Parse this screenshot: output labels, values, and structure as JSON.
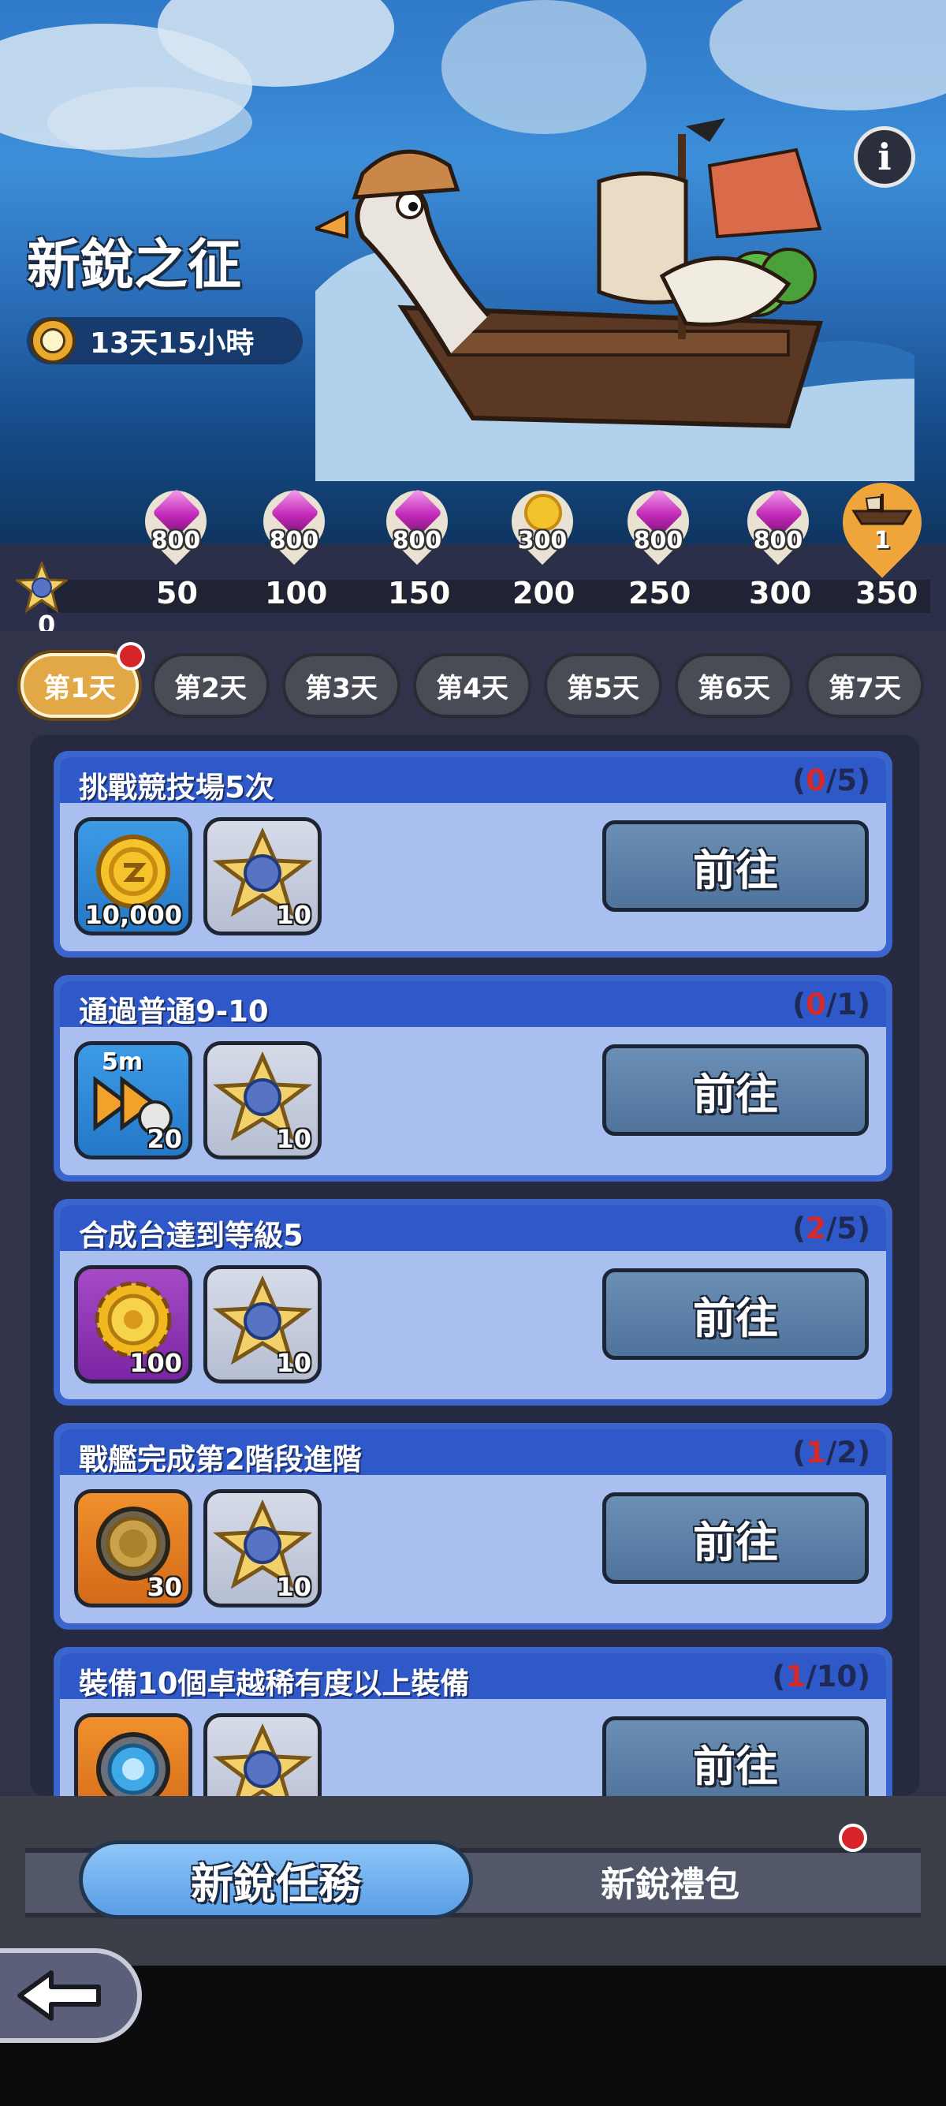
{
  "event": {
    "title": "新銳之征",
    "timer": "13天15小時",
    "info_button": "i"
  },
  "milestones": {
    "start_value": "0",
    "rewards": [
      {
        "points": "50",
        "reward_icon": "gem-icon",
        "amount": "800"
      },
      {
        "points": "100",
        "reward_icon": "gem-icon",
        "amount": "800"
      },
      {
        "points": "150",
        "reward_icon": "gem-icon",
        "amount": "800"
      },
      {
        "points": "200",
        "reward_icon": "gold-gear-icon",
        "amount": "300"
      },
      {
        "points": "250",
        "reward_icon": "gem-icon",
        "amount": "800"
      },
      {
        "points": "300",
        "reward_icon": "gem-icon",
        "amount": "800"
      },
      {
        "points": "350",
        "reward_icon": "ship-icon",
        "amount": "1"
      }
    ]
  },
  "day_tabs": [
    "第1天",
    "第2天",
    "第3天",
    "第4天",
    "第5天",
    "第6天",
    "第7天"
  ],
  "active_day": "第1天",
  "quests": [
    {
      "title": "挑戰競技場5次",
      "open": "(",
      "current": "0",
      "total": "/5)",
      "rewards": [
        {
          "icon": "gold-coin-icon",
          "count": "10,000"
        },
        {
          "icon": "anchor-star-icon",
          "count": "10"
        }
      ],
      "button": "前往"
    },
    {
      "title": "通過普通9-10",
      "open": "(",
      "current": "0",
      "total": "/1)",
      "rewards": [
        {
          "icon": "fast-forward-5m-icon",
          "label": "5m",
          "count": "20"
        },
        {
          "icon": "anchor-star-icon",
          "count": "10"
        }
      ],
      "button": "前往"
    },
    {
      "title": "合成台達到等級5",
      "open": "(",
      "current": "2",
      "total": "/5)",
      "rewards": [
        {
          "icon": "gold-gear-icon",
          "count": "100"
        },
        {
          "icon": "anchor-star-icon",
          "count": "10"
        }
      ],
      "button": "前往"
    },
    {
      "title": "戰艦完成第2階段進階",
      "open": "(",
      "current": "1",
      "total": "/2)",
      "rewards": [
        {
          "icon": "bronze-medal-icon",
          "count": "30"
        },
        {
          "icon": "anchor-star-icon",
          "count": "10"
        }
      ],
      "button": "前往"
    },
    {
      "title": "裝備10個卓越稀有度以上裝備",
      "open": "(",
      "current": "1",
      "total": "/10)",
      "rewards": [
        {
          "icon": "portal-ring-icon",
          "count": ""
        },
        {
          "icon": "anchor-star-icon",
          "count": ""
        }
      ],
      "button": "前往"
    }
  ],
  "bottom_tabs": {
    "active": "新銳任務",
    "inactive": "新銳禮包"
  },
  "colors": {
    "accent_gold": "#e2a845",
    "card_blue": "#3b64cc",
    "progress_red": "#d42a2a"
  }
}
